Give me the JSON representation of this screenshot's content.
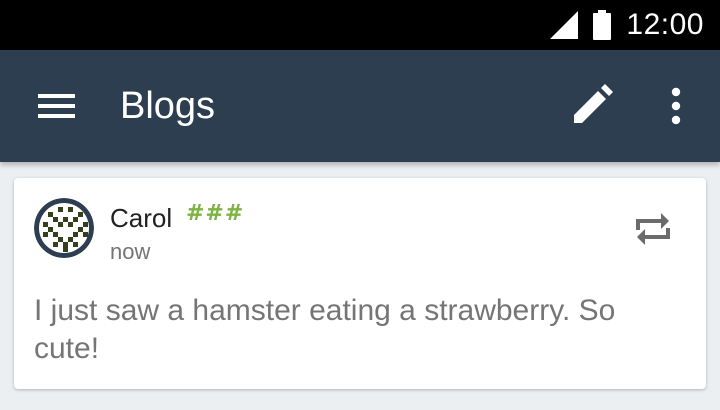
{
  "status_bar": {
    "time": "12:00",
    "icons": [
      "signal-icon",
      "battery-icon"
    ]
  },
  "app_bar": {
    "title": "Blogs",
    "icons": [
      "menu-icon",
      "edit-icon",
      "overflow-menu-icon"
    ],
    "background": "#2d3e50"
  },
  "post": {
    "author": "Carol",
    "tag": "###",
    "timestamp": "now",
    "body": "I just saw a hamster eating a strawberry. So cute!",
    "icons": [
      "avatar",
      "repost-icon"
    ],
    "tag_color": "#7cb342"
  }
}
